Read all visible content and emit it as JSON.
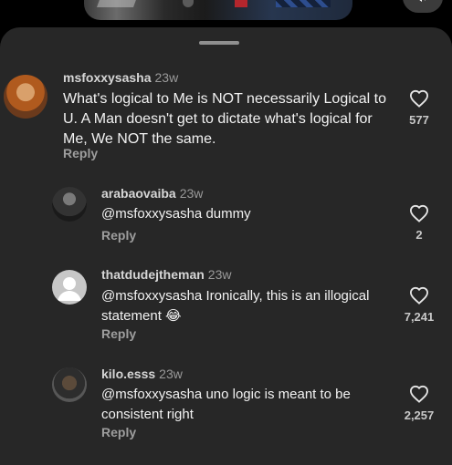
{
  "comments": [
    {
      "username": "msfoxxysasha",
      "time": "23w",
      "text": "What's logical to Me is NOT necessarily Logical to U. A Man doesn't get to dictate what's logical for Me, We NOT the same.",
      "reply_label": "Reply",
      "likes": "577"
    },
    {
      "username": "arabaovaiba",
      "time": "23w",
      "mention": "@msfoxxysasha",
      "text": "dummy",
      "reply_label": "Reply",
      "likes": "2"
    },
    {
      "username": "thatdudejtheman",
      "time": "23w",
      "mention": "@msfoxxysasha",
      "text": "Ironically, this is an illogical statement 😂",
      "reply_label": "Reply",
      "likes": "7,241"
    },
    {
      "username": "kilo.esss",
      "time": "23w",
      "mention": "@msfoxxysasha",
      "text": "uno logic is meant to be consistent right",
      "reply_label": "Reply",
      "likes": "2,257"
    }
  ],
  "icons": {
    "heart": "heart-outline-icon",
    "volume": "volume-icon"
  },
  "colors": {
    "sheet_background": "#272727",
    "reply_text": "#9e9e9e"
  }
}
